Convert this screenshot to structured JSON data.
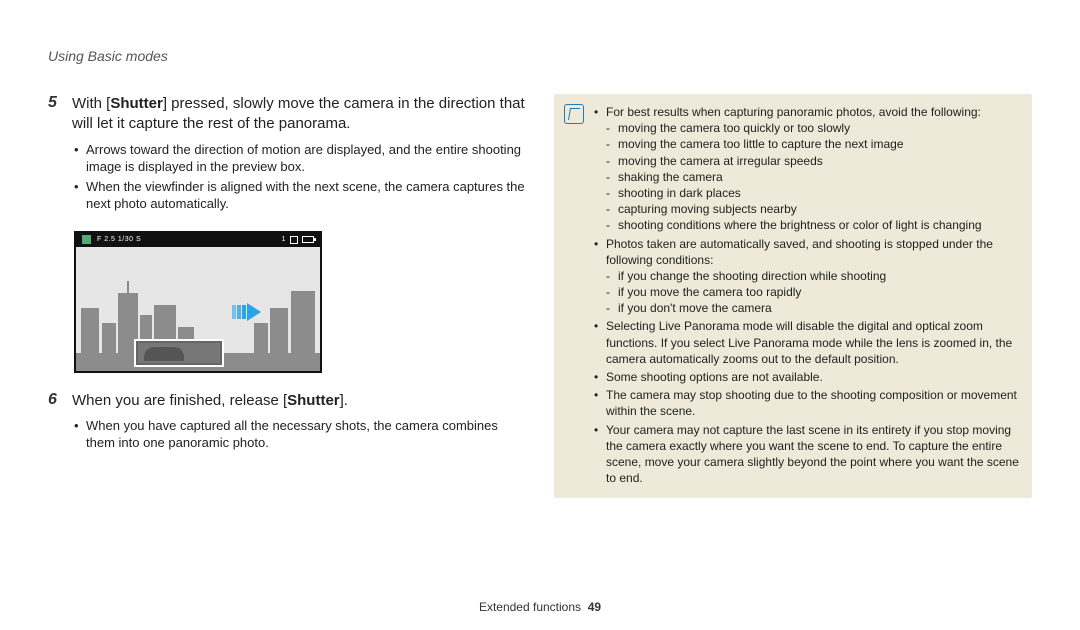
{
  "header": "Using Basic modes",
  "left": {
    "step5": {
      "num": "5",
      "pre": "With [",
      "bold": "Shutter",
      "post": "] pressed, slowly move the camera in the direction that will let it capture the rest of the panorama.",
      "bullets": [
        "Arrows toward the direction of motion are displayed, and the entire shooting image is displayed in the preview box.",
        "When the viewfinder is aligned with the next scene, the camera captures the next photo automatically."
      ]
    },
    "camera": {
      "exposure": "F 2.5  1/30 S",
      "count": "1"
    },
    "step6": {
      "num": "6",
      "pre": "When you are finished, release [",
      "bold": "Shutter",
      "post": "].",
      "bullets": [
        "When you have captured all the necessary shots, the camera combines them into one panoramic photo."
      ]
    }
  },
  "tip": {
    "b1": {
      "lead": "For best results when capturing panoramic photos, avoid the following:",
      "subs": [
        "moving the camera too quickly or too slowly",
        "moving the camera too little to capture the next image",
        "moving the camera at irregular speeds",
        "shaking the camera",
        "shooting in dark places",
        "capturing moving subjects nearby",
        "shooting conditions where the brightness or color of light is changing"
      ]
    },
    "b2": {
      "lead": "Photos taken are automatically saved, and shooting is stopped under the following conditions:",
      "subs": [
        "if you change the shooting direction while shooting",
        "if you move the camera too rapidly",
        "if you don't move the camera"
      ]
    },
    "b3": "Selecting Live Panorama mode will disable the digital and optical zoom functions. If you select Live Panorama mode while the lens is zoomed in, the camera automatically zooms out to the default position.",
    "b4": "Some shooting options are not available.",
    "b5": "The camera may stop shooting due to the shooting composition or movement within the scene.",
    "b6": "Your camera may not capture the last scene in its entirety if you stop moving the camera exactly where you want the scene to end. To capture the entire scene, move your camera slightly beyond the point where you want the scene to end."
  },
  "footer": {
    "section": "Extended functions",
    "page": "49"
  }
}
